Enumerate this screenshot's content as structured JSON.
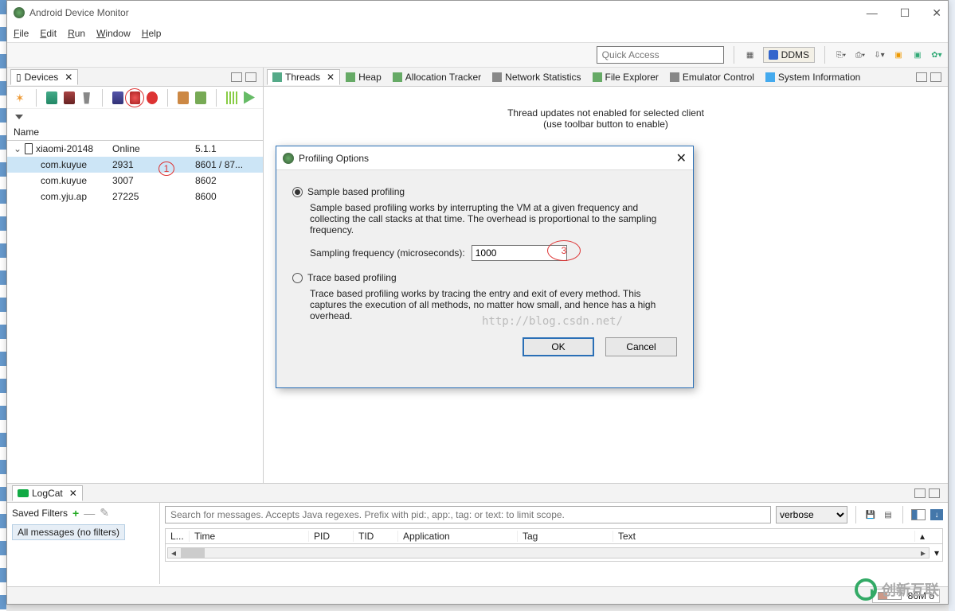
{
  "window": {
    "title": "Android Device Monitor"
  },
  "menubar": [
    "File",
    "Edit",
    "Run",
    "Window",
    "Help"
  ],
  "toolbar": {
    "quick_access_placeholder": "Quick Access",
    "perspective": "DDMS"
  },
  "left_panel": {
    "title": "Devices",
    "col1": "Name",
    "rows": [
      {
        "indent": 0,
        "name": "xiaomi-20148",
        "pid": "",
        "state": "Online",
        "port": "5.1.1",
        "expand": "v",
        "icon": "phone"
      },
      {
        "indent": 1,
        "name": "com.kuyue",
        "pid": "2931",
        "state": "",
        "port": "8601 / 87...",
        "selected": true
      },
      {
        "indent": 1,
        "name": "com.kuyue",
        "pid": "3007",
        "state": "",
        "port": "8602"
      },
      {
        "indent": 1,
        "name": "com.yju.ap",
        "pid": "27225",
        "state": "",
        "port": "8600"
      }
    ]
  },
  "right_panel": {
    "tabs": [
      "Threads",
      "Heap",
      "Allocation Tracker",
      "Network Statistics",
      "File Explorer",
      "Emulator Control",
      "System Information"
    ],
    "message_line1": "Thread updates not enabled for selected client",
    "message_line2": "(use toolbar button to enable)"
  },
  "dialog": {
    "title": "Profiling Options",
    "opt1_label": "Sample based profiling",
    "opt1_desc": "Sample based profiling works by interrupting the VM at a given frequency and collecting the call stacks at that time. The overhead is proportional to the sampling frequency.",
    "freq_label": "Sampling frequency (microseconds):",
    "freq_value": "1000",
    "opt2_label": "Trace based profiling",
    "opt2_desc": "Trace based profiling works by tracing the entry and exit of every method. This captures the execution of all methods, no matter how small, and hence has a high overhead.",
    "ok": "OK",
    "cancel": "Cancel"
  },
  "logcat": {
    "title": "LogCat",
    "saved_filters": "Saved Filters",
    "filter_item": "All messages (no filters)",
    "search_placeholder": "Search for messages. Accepts Java regexes. Prefix with pid:, app:, tag: or text: to limit scope.",
    "level": "verbose",
    "cols": [
      "L...",
      "Time",
      "PID",
      "TID",
      "Application",
      "Tag",
      "Text"
    ]
  },
  "status": {
    "mem": "86M o"
  },
  "watermark": "http://blog.csdn.net/",
  "annotations": {
    "one": "1",
    "three": "3"
  },
  "logo_text": "创新互联"
}
